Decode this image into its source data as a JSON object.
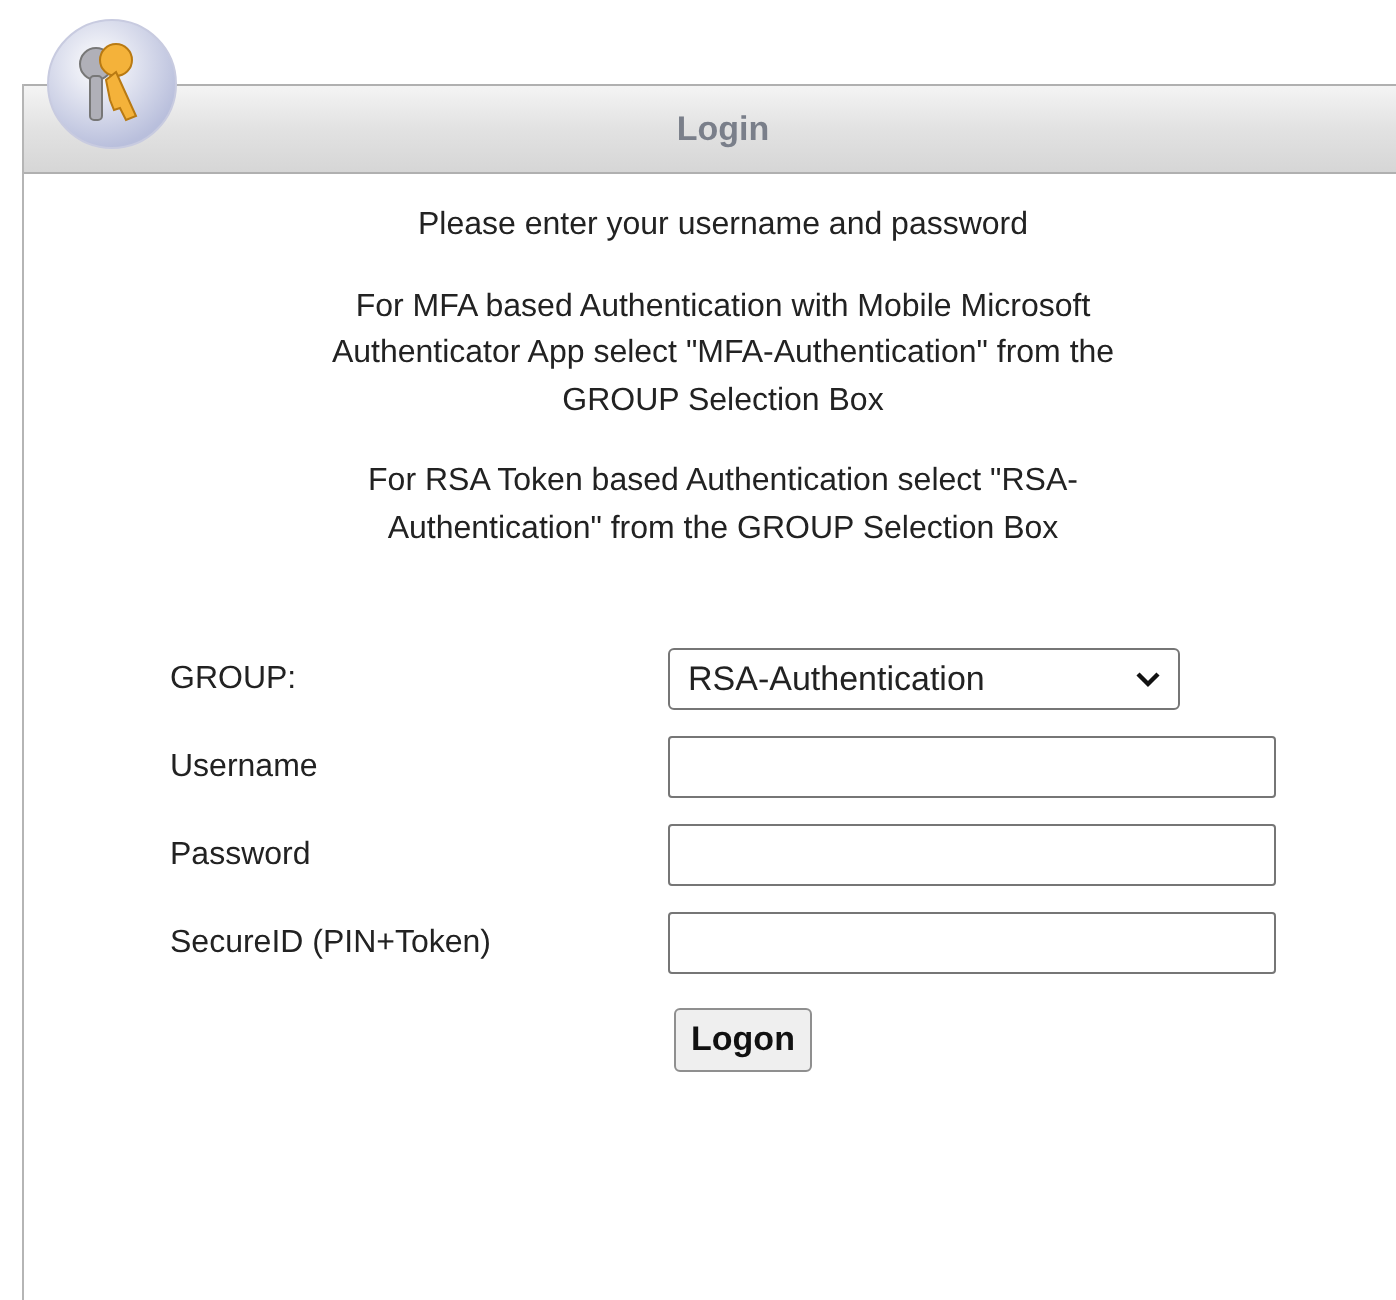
{
  "panel": {
    "title": "Login"
  },
  "instructions": [
    {
      "lines": [
        "Please enter your username and password"
      ]
    },
    {
      "lines": [
        "For MFA based Authentication with Mobile Microsoft",
        "Authenticator App select \"MFA-Authentication\" from the",
        "GROUP Selection Box"
      ]
    },
    {
      "lines": [
        "For RSA Token based Authentication select \"RSA-",
        "Authentication\" from the GROUP Selection Box"
      ]
    }
  ],
  "form": [
    {
      "kind": "select",
      "label": "GROUP:",
      "value": "RSA-Authentication"
    },
    {
      "kind": "text",
      "label": "Username"
    },
    {
      "kind": "password",
      "label": "Password"
    },
    {
      "kind": "text",
      "label": "SecureID (PIN+Token)"
    }
  ],
  "submit": {
    "label": "Logon"
  }
}
